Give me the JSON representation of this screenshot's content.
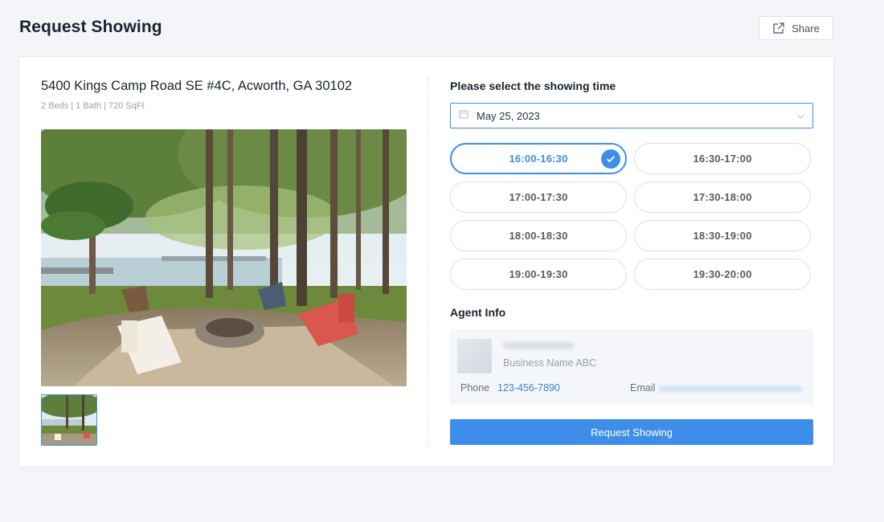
{
  "page": {
    "title": "Request Showing",
    "share_label": "Share"
  },
  "property": {
    "address": "5400 Kings Camp Road SE #4C, Acworth, GA 30102",
    "specs": "2 Beds | 1 Bath | 720 SqFt"
  },
  "showing": {
    "title": "Please select the showing time",
    "date": "May 25, 2023",
    "selected_slot": "16:00-16:30",
    "slots": [
      "16:00-16:30",
      "16:30-17:00",
      "17:00-17:30",
      "17:30-18:00",
      "18:00-18:30",
      "18:30-19:00",
      "19:00-19:30",
      "19:30-20:00"
    ]
  },
  "agent": {
    "title": "Agent Info",
    "business": "Business Name ABC",
    "phone_label": "Phone",
    "phone": "123-456-7890",
    "email_label": "Email"
  },
  "actions": {
    "request_label": "Request Showing"
  },
  "colors": {
    "accent": "#3d8ee8",
    "background": "#f4f5f8"
  },
  "icons": {
    "share": "share-icon",
    "calendar": "calendar-icon",
    "chevron": "chevron-down-icon",
    "check": "check-icon"
  }
}
